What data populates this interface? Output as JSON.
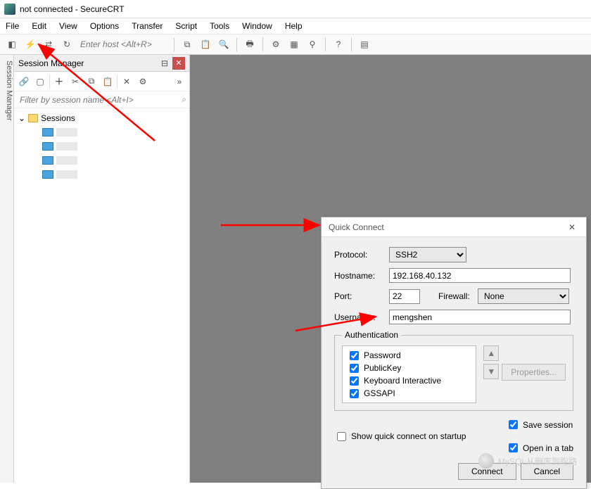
{
  "title": "not connected - SecureCRT",
  "menu": [
    "File",
    "Edit",
    "View",
    "Options",
    "Transfer",
    "Script",
    "Tools",
    "Window",
    "Help"
  ],
  "toolbar": {
    "host_placeholder": "Enter host <Alt+R>"
  },
  "sidebar_tab": "Session Manager",
  "panel": {
    "title": "Session Manager",
    "filter_placeholder": "Filter by session name <Alt+I>",
    "root": "Sessions"
  },
  "dialog": {
    "title": "Quick Connect",
    "labels": {
      "protocol": "Protocol:",
      "hostname": "Hostname:",
      "port": "Port:",
      "firewall": "Firewall:",
      "username": "Username:"
    },
    "values": {
      "protocol": "SSH2",
      "hostname": "192.168.40.132",
      "port": "22",
      "firewall": "None",
      "username": "mengshen"
    },
    "auth": {
      "legend": "Authentication",
      "items": [
        "Password",
        "PublicKey",
        "Keyboard Interactive",
        "GSSAPI"
      ],
      "properties": "Properties..."
    },
    "opts": {
      "startup": "Show quick connect on startup",
      "save": "Save session",
      "tab": "Open in a tab"
    },
    "buttons": {
      "connect": "Connect",
      "cancel": "Cancel"
    }
  },
  "watermark": "MySQL从删库到跑路"
}
